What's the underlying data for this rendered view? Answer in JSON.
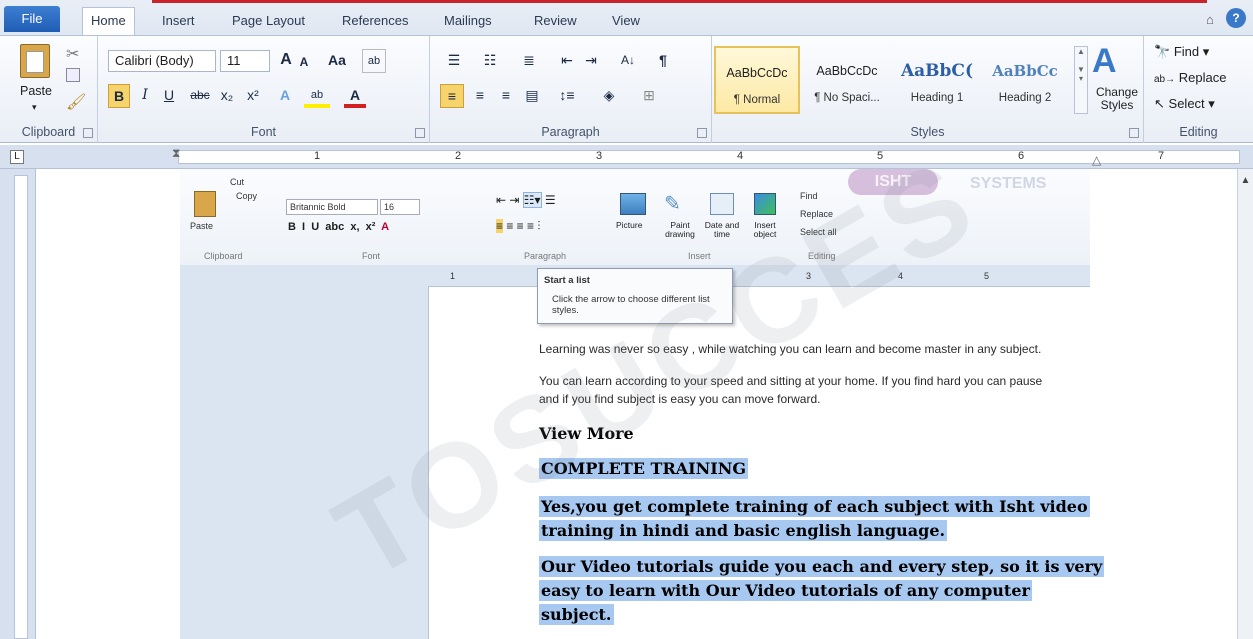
{
  "tabs": {
    "file": "File",
    "home": "Home",
    "insert": "Insert",
    "page_layout": "Page Layout",
    "references": "References",
    "mailings": "Mailings",
    "review": "Review",
    "view": "View"
  },
  "clipboard": {
    "paste": "Paste",
    "group": "Clipboard"
  },
  "font": {
    "name": "Calibri (Body)",
    "size": "11",
    "grow": "A",
    "shrink": "A",
    "case": "Aa",
    "bold": "B",
    "italic": "I",
    "underline": "U",
    "strike": "abc",
    "sub": "x₂",
    "sup": "x²",
    "color": "A",
    "group": "Font"
  },
  "paragraph": {
    "pilcrow": "¶",
    "sort": "A↓",
    "group": "Paragraph"
  },
  "styles": {
    "items": [
      {
        "sample": "AaBbCcDc",
        "name": "¶ Normal"
      },
      {
        "sample": "AaBbCcDc",
        "name": "¶ No Spaci..."
      },
      {
        "sample": "AaBbC(",
        "name": "Heading 1"
      },
      {
        "sample": "AaBbCc",
        "name": "Heading 2"
      }
    ],
    "change": "Change Styles",
    "group": "Styles"
  },
  "editing": {
    "find": "Find",
    "replace": "Replace",
    "select": "Select",
    "group": "Editing"
  },
  "ruler": [
    "1",
    "2",
    "3",
    "4",
    "5",
    "6",
    "7"
  ],
  "inner": {
    "cut": "Cut",
    "copy": "Copy",
    "paste": "Paste",
    "clipboard": "Clipboard",
    "font_name": "Britannic Bold",
    "font_size": "16",
    "font": "Font",
    "paragraph": "Paragraph",
    "picture": "Picture",
    "paint": "Paint drawing",
    "datetime": "Date and time",
    "insert_object": "Insert object",
    "insert": "Insert",
    "find": "Find",
    "replace": "Replace",
    "select_all": "Select all",
    "editing": "Editing",
    "ruler": [
      "1",
      "3",
      "4",
      "5"
    ]
  },
  "tooltip": {
    "title": "Start a list",
    "body": "Click the arrow to choose different list styles."
  },
  "document": {
    "p1": "Learning was never so easy , while watching you can learn and become master in any subject.",
    "p2a": "You can learn according to your speed and sitting at your home. If you find hard you can pause",
    "p2b": "and if you find subject is easy you can move forward.",
    "h1": "View More",
    "h2": "COMPLETE TRAINING",
    "h3a": "Yes,you get complete training of each subject with Isht video",
    "h3b": "training in hindi and basic english language.",
    "h4a": "Our Video tutorials guide you each and every step, so it is very",
    "h4b": "easy to learn with Our Video tutorials of any computer",
    "h4c": "subject."
  },
  "watermark": {
    "text": "TOSUCCES",
    "logo": "ISHT",
    "logo2": "SYSTEMS"
  },
  "colors": {
    "accent": "#2b63b8",
    "selection": "#a7c8f0",
    "ribbon": "#e9eef6"
  }
}
